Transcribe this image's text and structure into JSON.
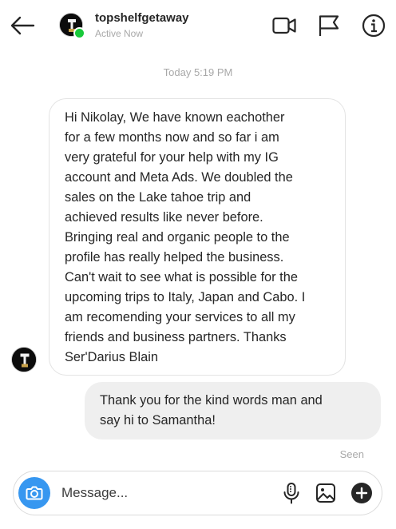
{
  "header": {
    "username": "topshelfgetaway",
    "status": "Active Now",
    "icons": [
      "back-arrow-icon",
      "video-call-icon",
      "flag-icon",
      "info-icon"
    ],
    "online_color": "#18c93a"
  },
  "thread": {
    "timestamp": "Today 5:19 PM",
    "messages": [
      {
        "direction": "incoming",
        "text": " Hi Nikolay, We have known eachother\nfor a few months now and so far i am\nvery grateful for your help with my IG\naccount and Meta Ads. We doubled the\nsales on the Lake tahoe trip and\nachieved results like never before.\nBringing real and organic people to the\nprofile has really helped the business.\nCan't wait to see what is possible for the\nupcoming trips to Italy, Japan and Cabo. I\nam recomending your services to all my\nfriends and business partners. Thanks\nSer'Darius Blain"
      },
      {
        "direction": "outgoing",
        "text": " Thank you for the kind words man and\nsay hi to Samantha!"
      }
    ],
    "seen_label": "Seen"
  },
  "composer": {
    "placeholder": "Message...",
    "icons": [
      "camera-icon",
      "microphone-icon",
      "image-icon",
      "plus-circle-icon"
    ],
    "accent": "#3797f0"
  }
}
